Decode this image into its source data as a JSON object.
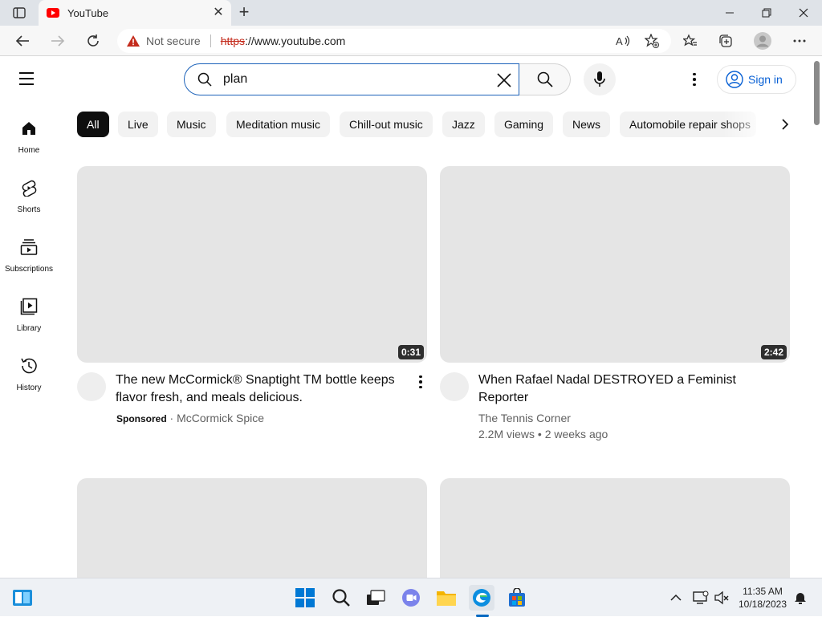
{
  "browser": {
    "tab_title": "YouTube",
    "address": {
      "security_label": "Not secure",
      "url_scheme": "https",
      "url_rest": "://www.youtube.com"
    }
  },
  "youtube": {
    "search": {
      "value": "plan"
    },
    "sign_in_label": "Sign in",
    "sidebar": [
      {
        "label": "Home",
        "icon": "home-icon"
      },
      {
        "label": "Shorts",
        "icon": "shorts-icon"
      },
      {
        "label": "Subscriptions",
        "icon": "subscriptions-icon"
      },
      {
        "label": "Library",
        "icon": "library-icon"
      },
      {
        "label": "History",
        "icon": "history-icon"
      }
    ],
    "chips": [
      "All",
      "Live",
      "Music",
      "Meditation music",
      "Chill-out music",
      "Jazz",
      "Gaming",
      "News",
      "Automobile repair shops"
    ],
    "videos": [
      {
        "title": "The new McCormick® Snaptight TM bottle keeps flavor fresh, and meals delicious.",
        "duration": "0:31",
        "sponsored_label": "Sponsored",
        "channel": "McCormick Spice"
      },
      {
        "title": "When Rafael Nadal DESTROYED a Feminist Reporter",
        "duration": "2:42",
        "channel": "The Tennis Corner",
        "stats": "2.2M views • 2 weeks ago"
      }
    ]
  },
  "taskbar": {
    "time": "11:35 AM",
    "date": "10/18/2023"
  },
  "colors": {
    "accent_blue": "#065fd4",
    "search_focus": "#1c62b9",
    "warning_red": "#c42b1c",
    "edge_blue": "#0067c0"
  }
}
